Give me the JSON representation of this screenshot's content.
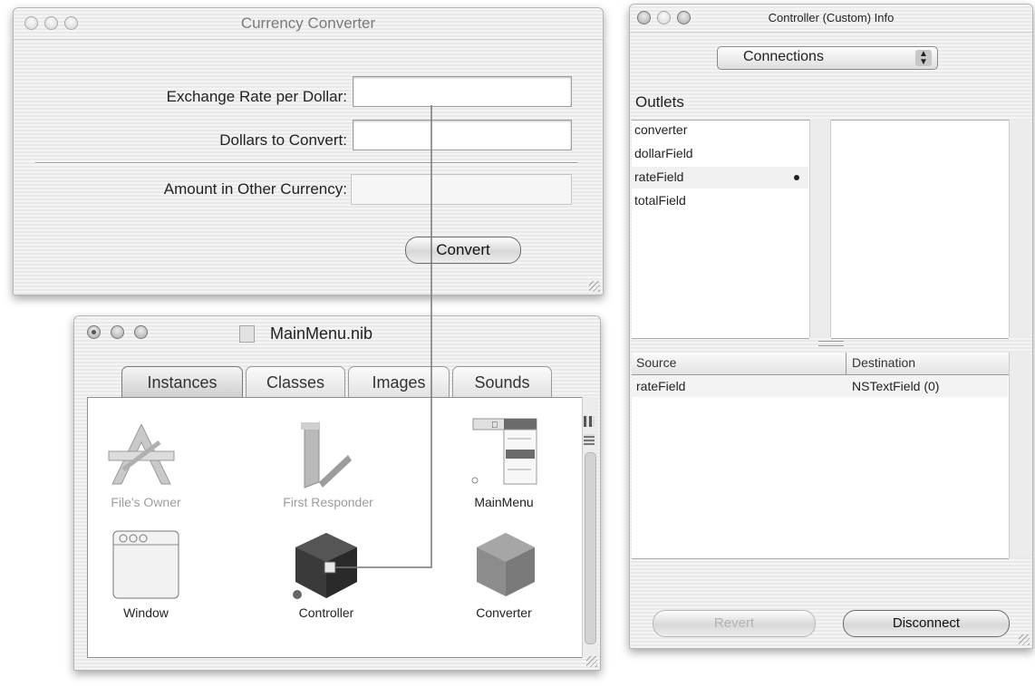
{
  "currency_window": {
    "title": "Currency Converter",
    "rate_label": "Exchange Rate per Dollar:",
    "dollars_label": "Dollars to Convert:",
    "amount_label": "Amount in Other Currency:",
    "rate_value": "",
    "dollars_value": "",
    "amount_value": "",
    "convert_button": "Convert"
  },
  "nib_window": {
    "title": "MainMenu.nib",
    "tabs": [
      "Instances",
      "Classes",
      "Images",
      "Sounds"
    ],
    "selected_tab": "Instances",
    "instances": [
      {
        "label": "File's Owner",
        "icon": "app-icon",
        "dimmed": true
      },
      {
        "label": "First Responder",
        "icon": "first-responder-icon",
        "dimmed": true
      },
      {
        "label": "MainMenu",
        "icon": "menu-icon",
        "dimmed": false
      },
      {
        "label": "Window",
        "icon": "window-icon",
        "dimmed": false
      },
      {
        "label": "Controller",
        "icon": "cube-icon",
        "dimmed": false
      },
      {
        "label": "Converter",
        "icon": "cube-icon",
        "dimmed": false
      }
    ]
  },
  "info_window": {
    "title": "Controller (Custom) Info",
    "popup_value": "Connections",
    "outlets_header": "Outlets",
    "outlets": [
      "converter",
      "dollarField",
      "rateField",
      "totalField"
    ],
    "connected_outlet": "rateField",
    "table_headers": {
      "source": "Source",
      "destination": "Destination"
    },
    "connections": [
      {
        "source": "rateField",
        "destination": "NSTextField (0)"
      }
    ],
    "revert_button": "Revert",
    "disconnect_button": "Disconnect"
  }
}
